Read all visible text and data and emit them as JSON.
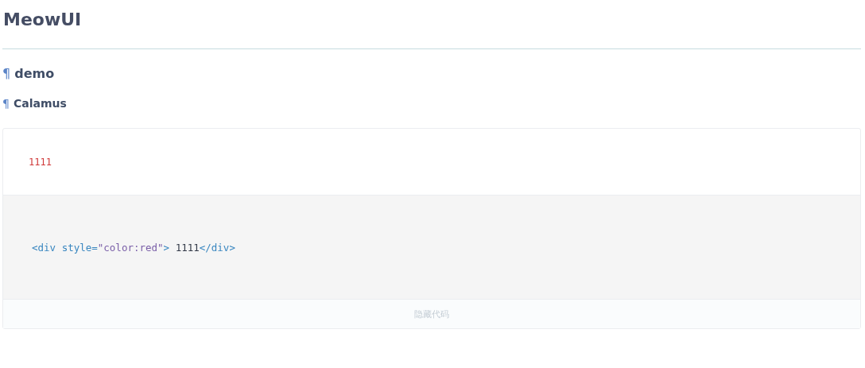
{
  "site_title": "MeowUI",
  "headings": [
    {
      "anchor": "¶",
      "text": "demo",
      "kind": "section"
    },
    {
      "anchor": "¶",
      "text": "Calamus",
      "kind": "subsection"
    }
  ],
  "demo": {
    "preview": "1111",
    "code_tokens": [
      {
        "kind": "tag",
        "text": "<div"
      },
      {
        "kind": "attr",
        "text": " style="
      },
      {
        "kind": "string",
        "text": "\"color:red\""
      },
      {
        "kind": "tag",
        "text": ">"
      },
      {
        "kind": "plain",
        "text": " 1111"
      },
      {
        "kind": "tag",
        "text": "</div>"
      }
    ],
    "toggle": "隐藏代码"
  }
}
